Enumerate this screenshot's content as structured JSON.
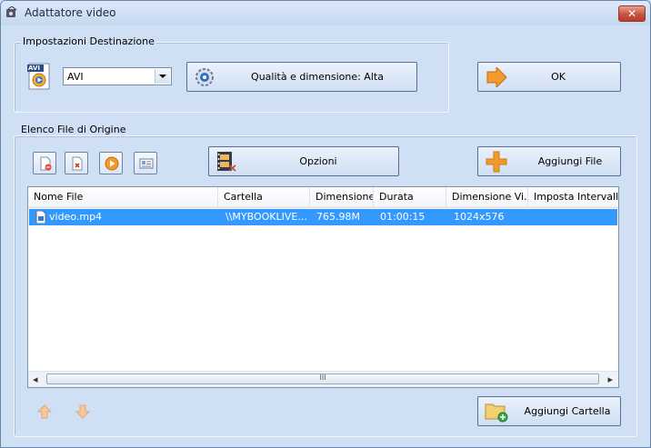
{
  "window": {
    "title": "Adattatore video",
    "close_glyph": "✕"
  },
  "destination": {
    "group_label": "Impostazioni Destinazione",
    "format_icon_badge": "AVI",
    "format_value": "AVI",
    "quality_button": "Qualità e dimensione: Alta",
    "ok_button": "OK"
  },
  "source": {
    "group_label": "Elenco File di Origine",
    "options_button": "Opzioni",
    "add_file_button": "Aggiungi File",
    "add_folder_button": "Aggiungi Cartella",
    "columns": [
      "Nome File",
      "Cartella",
      "Dimensione",
      "Durata",
      "Dimensione Vi...",
      "Imposta Intervallo"
    ],
    "rows": [
      {
        "name": "video.mp4",
        "folder": "\\\\MYBOOKLIVE...",
        "size": "765.98M",
        "duration": "01:00:15",
        "resolution": "1024x576",
        "interval": ""
      }
    ],
    "scroll_thumb_glyph": "III",
    "scroll_left_glyph": "◂",
    "scroll_right_glyph": "▸"
  },
  "icons": [
    "app-icon",
    "avi-file-icon",
    "quality-gear-icon",
    "ok-arrow-icon",
    "remove-file-icon",
    "delete-icon",
    "play-icon",
    "info-card-icon",
    "film-clip-icon",
    "plus-icon",
    "folder-add-icon",
    "up-arrow-icon",
    "down-arrow-icon"
  ],
  "colors": {
    "accent": "#3399ff",
    "orange": "#f39a2a",
    "window_bg": "#cfe0f5"
  }
}
